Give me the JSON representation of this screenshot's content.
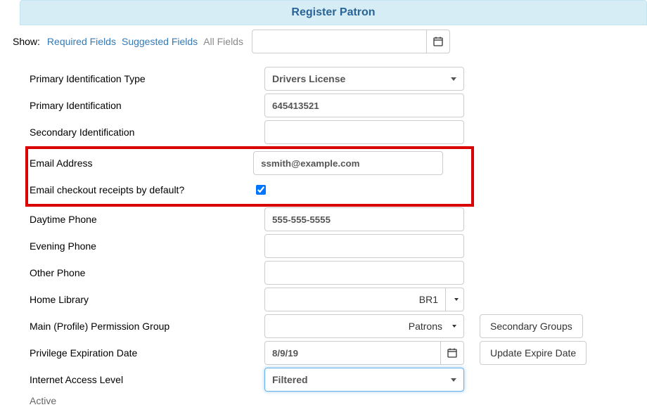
{
  "header": {
    "title": "Register Patron"
  },
  "toolbar": {
    "show_label": "Show:",
    "required": "Required Fields",
    "suggested": "Suggested Fields",
    "all": "All Fields",
    "global_date": ""
  },
  "fields": {
    "primary_id_type": {
      "label": "Primary Identification Type",
      "value": "Drivers License"
    },
    "primary_id": {
      "label": "Primary Identification",
      "value": "645413521"
    },
    "secondary_id": {
      "label": "Secondary Identification",
      "value": ""
    },
    "email": {
      "label": "Email Address",
      "value": "ssmith@example.com"
    },
    "email_receipts": {
      "label": "Email checkout receipts by default?",
      "checked": true
    },
    "day_phone": {
      "label": "Daytime Phone",
      "value": "555-555-5555"
    },
    "eve_phone": {
      "label": "Evening Phone",
      "value": ""
    },
    "other_phone": {
      "label": "Other Phone",
      "value": ""
    },
    "home_library": {
      "label": "Home Library",
      "value": "BR1"
    },
    "perm_group": {
      "label": "Main (Profile) Permission Group",
      "value": "Patrons"
    },
    "priv_exp": {
      "label": "Privilege Expiration Date",
      "value": "8/9/19"
    },
    "internet": {
      "label": "Internet Access Level",
      "value": "Filtered"
    },
    "active": {
      "label": "Active"
    }
  },
  "buttons": {
    "secondary_groups": "Secondary Groups",
    "update_expire": "Update Expire Date"
  },
  "icons": {
    "calendar": "📅"
  }
}
